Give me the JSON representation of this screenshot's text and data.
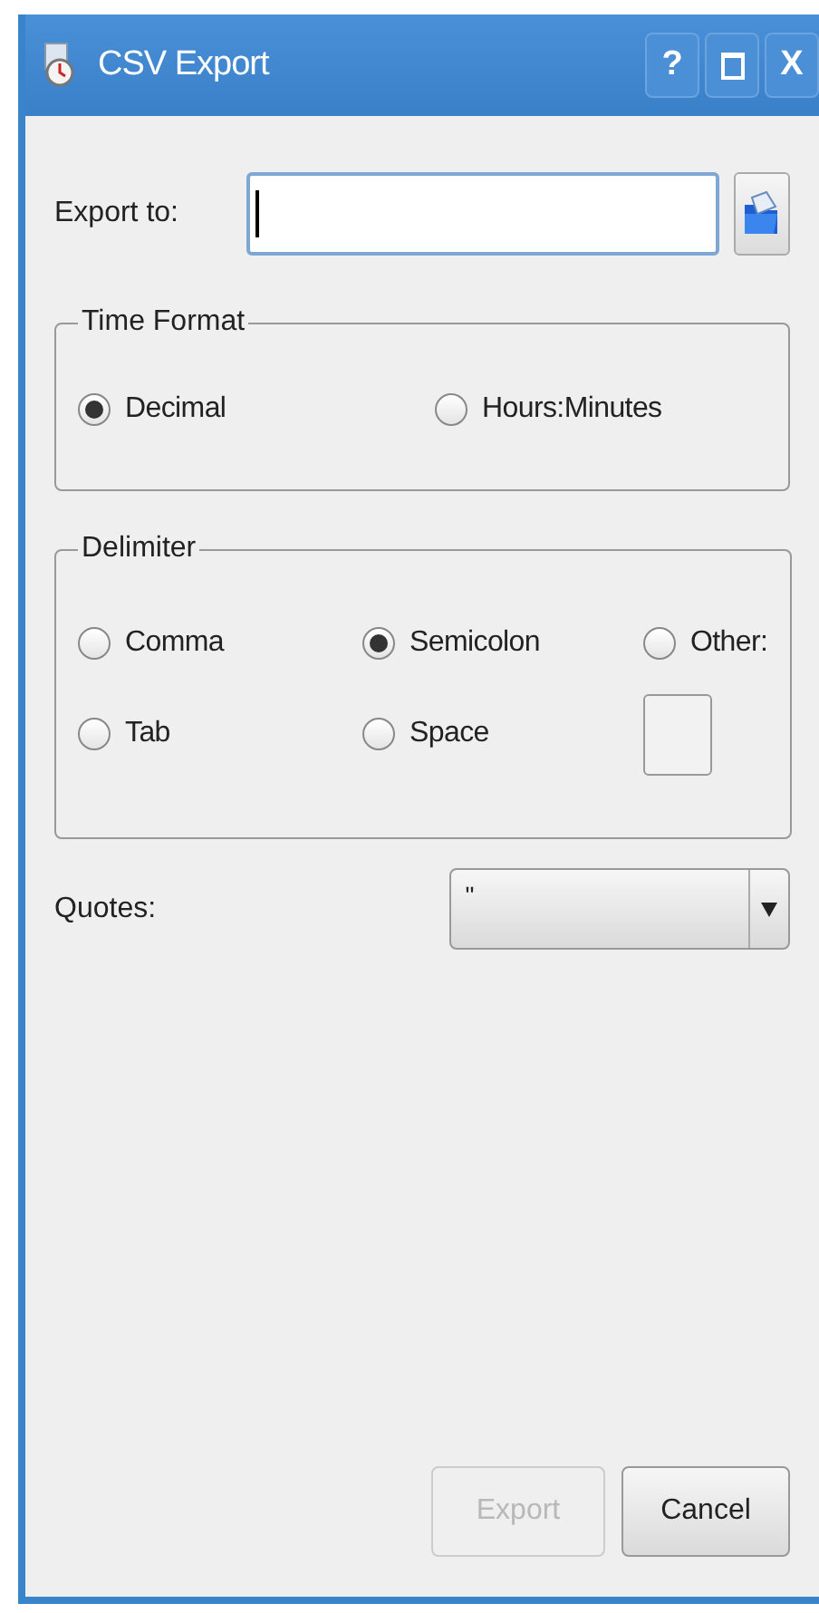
{
  "window": {
    "title": "CSV Export",
    "buttons": [
      {
        "kind": "help",
        "label": "?"
      },
      {
        "kind": "maximize"
      },
      {
        "kind": "close",
        "label": "X"
      }
    ]
  },
  "export_to": {
    "label": "Export to:"
  },
  "time_format": {
    "title": "Time Format",
    "options": [
      {
        "label": "Decimal",
        "selected": true
      },
      {
        "label": "Hours:Minutes",
        "selected": false
      }
    ]
  },
  "delimiter": {
    "title": "Delimiter",
    "options": [
      {
        "label": "Comma",
        "selected": false
      },
      {
        "label": "Semicolon",
        "selected": true
      },
      {
        "label": "Other:",
        "selected": false
      },
      {
        "label": "Tab",
        "selected": false
      },
      {
        "label": "Space",
        "selected": false
      }
    ]
  },
  "quotes": {
    "label": "Quotes:",
    "value": "\""
  },
  "buttons": [
    {
      "label": "Export",
      "disabled": true
    },
    {
      "label": "Cancel",
      "disabled": false
    }
  ]
}
